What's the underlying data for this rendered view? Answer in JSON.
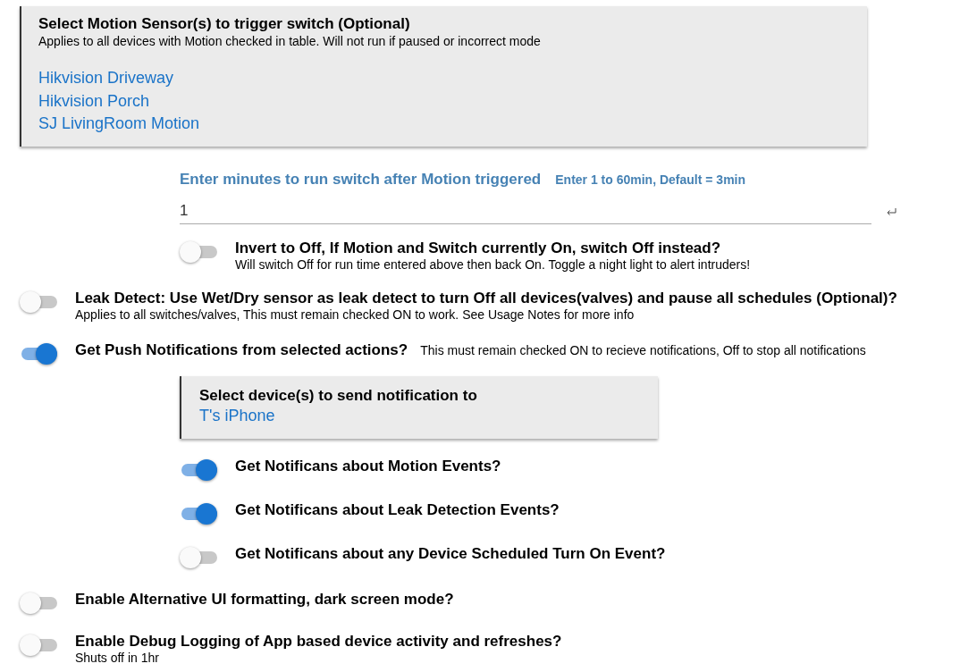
{
  "items": [
    {
      "kind": "card",
      "indented": false,
      "title": "Select Motion Sensor(s) to trigger switch (Optional)",
      "description": "Applies to all devices with Motion checked in table. Will not run if paused or incorrect mode",
      "devices": [
        "Hikvision Driveway",
        "Hikvision Porch",
        "SJ LivingRoom Motion"
      ]
    },
    {
      "kind": "input",
      "label": "Enter minutes to run switch after Motion triggered",
      "hint": "Enter 1 to 60min, Default = 3min",
      "value": "1"
    },
    {
      "kind": "toggle",
      "indented": true,
      "on": false,
      "label": "Invert to Off, If Motion and Switch currently On, switch Off instead?",
      "description": "Will switch Off for run time entered above then back On. Toggle a night light to alert intruders!"
    },
    {
      "kind": "toggle",
      "indented": false,
      "on": false,
      "label": "Leak Detect: Use Wet/Dry sensor as leak detect to turn Off all devices(valves) and pause all schedules (Optional)?",
      "description": "Applies to all switches/valves, This must remain checked ON to work. See Usage Notes for more info"
    },
    {
      "kind": "toggle",
      "indented": false,
      "on": true,
      "label": "Get Push Notifications from selected actions?",
      "note": "This must remain checked ON to recieve notifications, Off to stop all notifications"
    },
    {
      "kind": "card",
      "indented": true,
      "title": "Select device(s) to send notification to",
      "devices": [
        "T's iPhone"
      ]
    },
    {
      "kind": "toggle",
      "indented": true,
      "on": true,
      "label": "Get Notificans about Motion Events?"
    },
    {
      "kind": "toggle",
      "indented": true,
      "on": true,
      "label": "Get Notificans about Leak Detection Events?"
    },
    {
      "kind": "toggle",
      "indented": true,
      "on": false,
      "label": "Get Notificans about any Device Scheduled Turn On Event?"
    },
    {
      "kind": "toggle",
      "indented": false,
      "on": false,
      "label": "Enable Alternative UI formatting, dark screen mode?"
    },
    {
      "kind": "toggle",
      "indented": false,
      "on": false,
      "label": "Enable Debug Logging of App based device activity and refreshes?",
      "description": "Shuts off in 1hr"
    }
  ]
}
